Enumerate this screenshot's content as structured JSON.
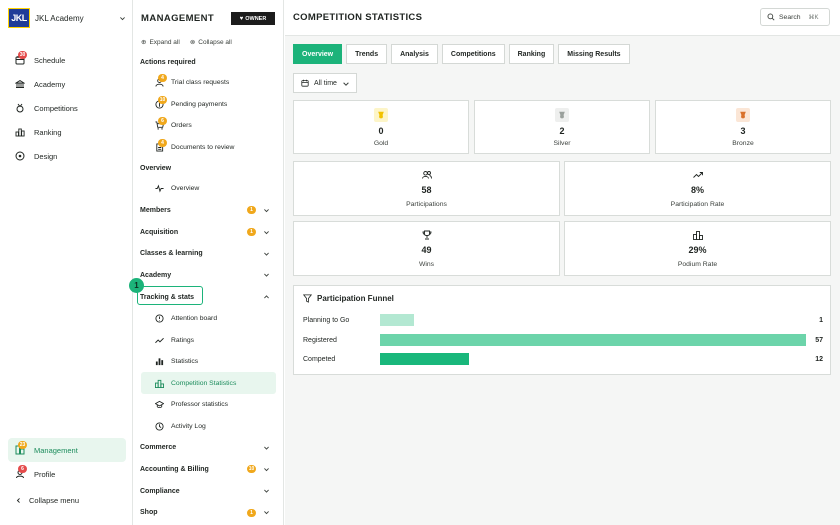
{
  "account": {
    "logo": "JKL",
    "name": "JKL Academy"
  },
  "app_nav": {
    "items": [
      {
        "label": "Schedule",
        "icon": "calendar-icon",
        "badge": "30"
      },
      {
        "label": "Academy",
        "icon": "academy-icon"
      },
      {
        "label": "Competitions",
        "icon": "competitions-icon"
      },
      {
        "label": "Ranking",
        "icon": "ranking-icon"
      },
      {
        "label": "Design",
        "icon": "palette-icon"
      }
    ],
    "bottom": [
      {
        "label": "Management",
        "icon": "management-icon",
        "badge": "23",
        "active": true
      },
      {
        "label": "Profile",
        "icon": "profile-icon",
        "badge": "6"
      }
    ],
    "collapse_label": "Collapse menu"
  },
  "management": {
    "title": "MANAGEMENT",
    "role": "OWNER",
    "expand_all": "Expand all",
    "collapse_all": "Collapse all",
    "actions_title": "Actions required",
    "actions": [
      {
        "label": "Trial class requests",
        "badge": "4"
      },
      {
        "label": "Pending payments",
        "badge": "10"
      },
      {
        "label": "Orders",
        "badge": "6"
      },
      {
        "label": "Documents to review",
        "badge": "4"
      }
    ],
    "overview_title": "Overview",
    "overview_item": "Overview",
    "sections": [
      {
        "label": "Members",
        "badge": "1"
      },
      {
        "label": "Acquisition",
        "badge": "1"
      },
      {
        "label": "Classes & learning"
      },
      {
        "label": "Academy"
      }
    ],
    "tracking_title": "Tracking & stats",
    "tracking_items": [
      {
        "label": "Attention board"
      },
      {
        "label": "Ratings"
      },
      {
        "label": "Statistics"
      },
      {
        "label": "Competition Statistics",
        "active": true
      },
      {
        "label": "Professor statistics"
      },
      {
        "label": "Activity Log"
      }
    ],
    "more_sections": [
      {
        "label": "Commerce"
      },
      {
        "label": "Accounting & Billing",
        "badge": "10"
      },
      {
        "label": "Compliance"
      },
      {
        "label": "Shop",
        "badge": "1"
      }
    ],
    "step_marker": "1"
  },
  "main": {
    "title": "COMPETITION STATISTICS",
    "search_label": "Search",
    "search_shortcut": "⌘K",
    "tabs": [
      "Overview",
      "Trends",
      "Analysis",
      "Competitions",
      "Ranking",
      "Missing Results"
    ],
    "active_tab": "Overview",
    "range": "All time",
    "medals": [
      {
        "value": "0",
        "label": "Gold",
        "color": "#f2c200",
        "bg": "#fdf5c8"
      },
      {
        "value": "2",
        "label": "Silver",
        "color": "#9aa09c",
        "bg": "#eeefee"
      },
      {
        "value": "3",
        "label": "Bronze",
        "color": "#d9712b",
        "bg": "#fbe6d6"
      }
    ],
    "stats": [
      {
        "value": "58",
        "label": "Participations",
        "icon": "users-icon"
      },
      {
        "value": "8%",
        "label": "Participation Rate",
        "icon": "trend-up-icon"
      },
      {
        "value": "49",
        "label": "Wins",
        "icon": "trophy-icon"
      },
      {
        "value": "29%",
        "label": "Podium Rate",
        "icon": "podium-icon"
      }
    ],
    "funnel": {
      "title": "Participation Funnel",
      "rows": [
        {
          "label": "Planning to Go",
          "value": 1,
          "display": "1",
          "fraction": 0.08,
          "color": "#b3e8d2"
        },
        {
          "label": "Registered",
          "value": 57,
          "display": "57",
          "fraction": 1.0,
          "color": "#6cd4aa"
        },
        {
          "label": "Competed",
          "value": 12,
          "display": "12",
          "fraction": 0.21,
          "color": "#19b77b"
        }
      ]
    }
  },
  "colors": {
    "accent": "#1cb37a",
    "active_bg": "#e8f6ee",
    "badge_red": "#e44b4b",
    "badge_orange": "#f0a81c"
  }
}
